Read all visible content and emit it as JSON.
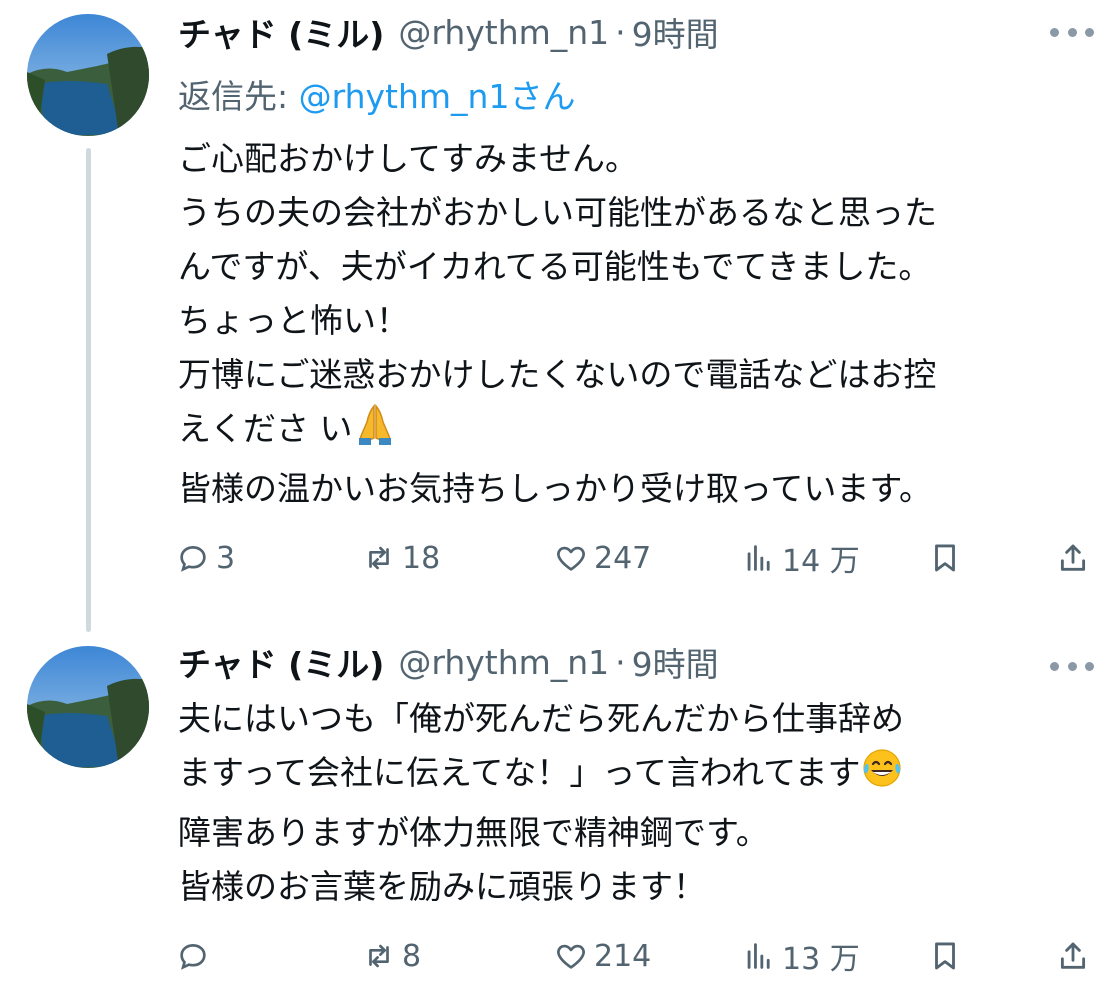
{
  "tweets": [
    {
      "name": "チャド (ミル)",
      "handle": "@rhythm_n1",
      "time": "9時間",
      "reply_prefix": "返信先: ",
      "reply_handle": "@rhythm_n1さん",
      "lines": [
        "ご心配おかけしてすみません。",
        "うちの夫の会社がおかしい可能性があるなと思った",
        "んですが、夫がイカれてる可能性もでてきました。",
        "ちょっと怖い！",
        "万博にご迷惑おかけしたくないので電話などはお控",
        "えくださ い",
        "皆様の温かいお気持ちしっかり受け取っています。"
      ],
      "emoji": "folded-hands",
      "replies": "3",
      "retweets": "18",
      "likes": "247",
      "views": "14 万"
    },
    {
      "name": "チャド (ミル)",
      "handle": "@rhythm_n1",
      "time": "9時間",
      "lines": [
        "夫にはいつも「俺が死んだら死んだから仕事辞め",
        "ますって会社に伝えてな！」って言われてます",
        "障害ありますが体力無限で精神鋼です。",
        "皆様のお言葉を励みに頑張ります！"
      ],
      "emoji": "tears-of-joy",
      "replies": "",
      "retweets": "8",
      "likes": "214",
      "views": "13 万"
    }
  ],
  "colors": {
    "text": "#0f1419",
    "secondary": "#536471",
    "link": "#1d9bf0",
    "thread_line": "#cfd9de"
  }
}
